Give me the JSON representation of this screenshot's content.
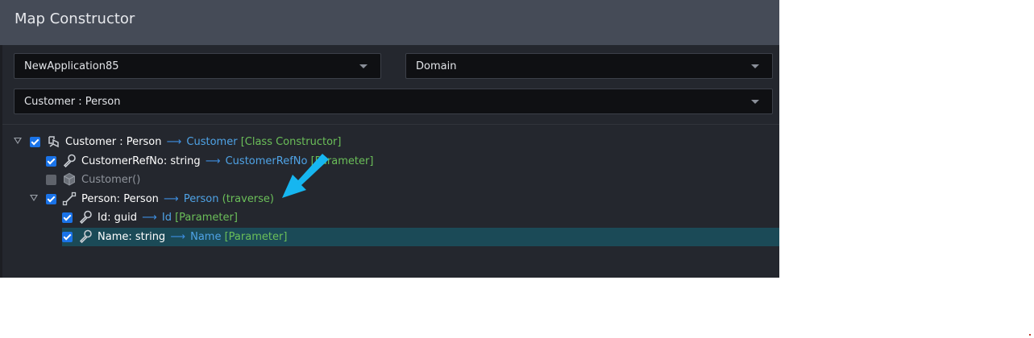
{
  "window": {
    "title": "Map Constructor"
  },
  "selectors": {
    "application": "NewApplication85",
    "designer": "Domain",
    "element": "Customer : Person"
  },
  "tree": [
    {
      "name": "Customer : Person",
      "arrow": "⟶",
      "target": "Customer",
      "tag": "[Class Constructor]"
    },
    {
      "name": "CustomerRefNo: string",
      "arrow": "⟶",
      "target": "CustomerRefNo",
      "tag": "[Parameter]"
    },
    {
      "name": "Customer()"
    },
    {
      "name": "Person: Person",
      "arrow": "⟶",
      "target": "Person",
      "tag": "(traverse)"
    },
    {
      "name": "Id: guid",
      "arrow": "⟶",
      "target": "Id",
      "tag": "[Parameter]"
    },
    {
      "name": "Name: string",
      "arrow": "⟶",
      "target": "Name",
      "tag": "[Parameter]"
    }
  ],
  "icons": {
    "root": "class-constructor-icon",
    "param": "wrench-icon",
    "ctor": "cube-icon",
    "traverse": "association-icon"
  },
  "colors": {
    "accent": "#1a73e8",
    "target": "#4fa3e6",
    "tag": "#6bbf59",
    "selected_row": "#1b4a57",
    "annotation_arrow": "#16b6f0"
  }
}
